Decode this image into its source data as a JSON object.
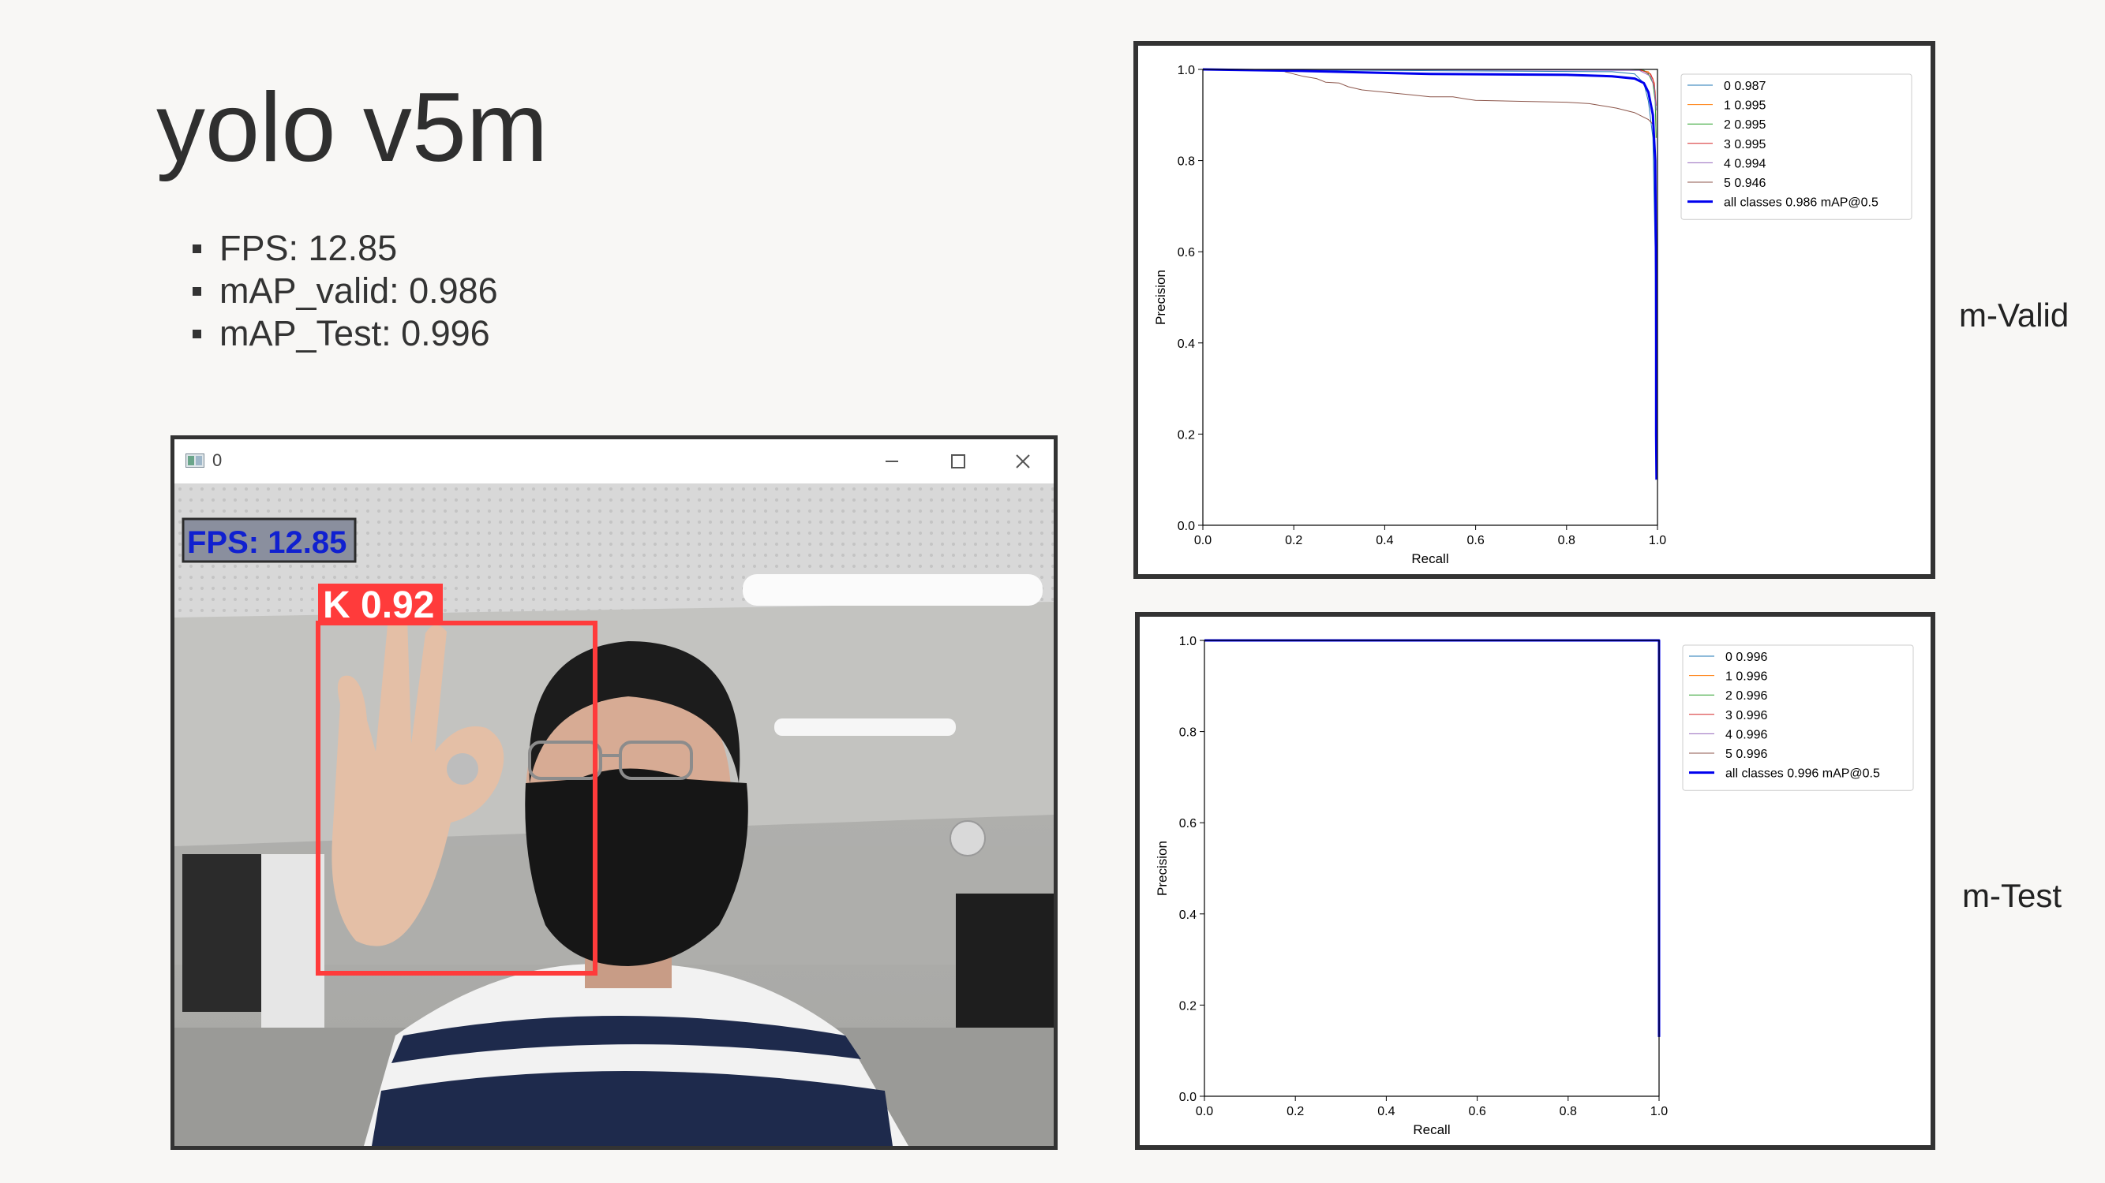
{
  "slide": {
    "title": "yolo v5m",
    "bullets": [
      "FPS: 12.85",
      "mAP_valid: 0.986",
      "mAP_Test: 0.996"
    ],
    "valid_label": "m-Valid",
    "test_label": "m-Test"
  },
  "camera_window": {
    "title": "0",
    "fps_overlay": "FPS: 12.85",
    "detection_label": "K 0.92",
    "icons": [
      "app-icon",
      "minimize-icon",
      "maximize-icon",
      "close-icon"
    ]
  },
  "colors": {
    "detection_box": "#ff3b3b",
    "fps_text": "#1020d0",
    "all_classes": "#0000ee",
    "class_0": "#1f77b4",
    "class_1": "#ff7f0e",
    "class_2": "#2ca02c",
    "class_3": "#d62728",
    "class_4": "#9467bd",
    "class_5": "#8c564b"
  },
  "chart_data": [
    {
      "type": "line",
      "xlabel": "Recall",
      "ylabel": "Precision",
      "xlim": [
        0,
        1
      ],
      "ylim": [
        0,
        1
      ],
      "xticks": [
        "0.0",
        "0.2",
        "0.4",
        "0.6",
        "0.8",
        "1.0"
      ],
      "yticks": [
        "0.0",
        "0.2",
        "0.4",
        "0.6",
        "0.8",
        "1.0"
      ],
      "legend_position": "top-right",
      "series": [
        {
          "name": "0 0.987",
          "color": "#1f77b4",
          "width": 1,
          "x": [
            0,
            0.9,
            0.95,
            0.97,
            0.98,
            0.99,
            0.995,
            0.996,
            0.996
          ],
          "y": [
            1,
            0.995,
            0.99,
            0.97,
            0.93,
            0.85,
            0.6,
            0.3,
            0.2
          ]
        },
        {
          "name": "1 0.995",
          "color": "#ff7f0e",
          "width": 1,
          "x": [
            0,
            0.95,
            0.98,
            0.99,
            0.995,
            0.997
          ],
          "y": [
            1,
            1,
            0.995,
            0.98,
            0.95,
            0.85
          ]
        },
        {
          "name": "2 0.995",
          "color": "#2ca02c",
          "width": 1,
          "x": [
            0,
            0.94,
            0.97,
            0.98,
            0.99,
            0.995,
            0.997
          ],
          "y": [
            1,
            1,
            0.998,
            0.99,
            0.97,
            0.93,
            0.85
          ]
        },
        {
          "name": "3 0.995",
          "color": "#d62728",
          "width": 1,
          "x": [
            0,
            0.96,
            0.985,
            0.993,
            0.997
          ],
          "y": [
            1,
            1,
            0.99,
            0.97,
            0.92
          ]
        },
        {
          "name": "4 0.994",
          "color": "#9467bd",
          "width": 1,
          "x": [
            0,
            0.96,
            0.985,
            0.993,
            0.997
          ],
          "y": [
            1,
            0.998,
            0.985,
            0.96,
            0.91
          ]
        },
        {
          "name": "5 0.946",
          "color": "#8c564b",
          "width": 1,
          "x": [
            0.18,
            0.2,
            0.22,
            0.25,
            0.27,
            0.3,
            0.32,
            0.35,
            0.38,
            0.4,
            0.45,
            0.5,
            0.55,
            0.58,
            0.6,
            0.7,
            0.8,
            0.85,
            0.88,
            0.91,
            0.93,
            0.95,
            0.96,
            0.97,
            0.98,
            0.99
          ],
          "y": [
            0.995,
            0.99,
            0.985,
            0.98,
            0.972,
            0.97,
            0.962,
            0.955,
            0.952,
            0.95,
            0.945,
            0.94,
            0.94,
            0.935,
            0.932,
            0.93,
            0.928,
            0.925,
            0.92,
            0.915,
            0.91,
            0.905,
            0.9,
            0.895,
            0.89,
            0.88
          ]
        },
        {
          "name": "all classes 0.986 mAP@0.5",
          "color": "#0000ee",
          "width": 3,
          "x": [
            0,
            0.2,
            0.5,
            0.8,
            0.9,
            0.95,
            0.97,
            0.98,
            0.99,
            0.995,
            0.997,
            0.997,
            0.998
          ],
          "y": [
            1,
            0.997,
            0.99,
            0.988,
            0.985,
            0.98,
            0.97,
            0.95,
            0.9,
            0.8,
            0.55,
            0.2,
            0.1
          ]
        }
      ]
    },
    {
      "type": "line",
      "xlabel": "Recall",
      "ylabel": "Precision",
      "xlim": [
        0,
        1
      ],
      "ylim": [
        0,
        1
      ],
      "xticks": [
        "0.0",
        "0.2",
        "0.4",
        "0.6",
        "0.8",
        "1.0"
      ],
      "yticks": [
        "0.0",
        "0.2",
        "0.4",
        "0.6",
        "0.8",
        "1.0"
      ],
      "legend_position": "top-right",
      "series": [
        {
          "name": "0 0.996",
          "color": "#1f77b4",
          "width": 1,
          "x": [
            0,
            1,
            1
          ],
          "y": [
            1,
            1,
            0.13
          ]
        },
        {
          "name": "1 0.996",
          "color": "#ff7f0e",
          "width": 1,
          "x": [
            0,
            1,
            1
          ],
          "y": [
            1,
            1,
            0.13
          ]
        },
        {
          "name": "2 0.996",
          "color": "#2ca02c",
          "width": 1,
          "x": [
            0,
            1,
            1
          ],
          "y": [
            1,
            1,
            0.13
          ]
        },
        {
          "name": "3 0.996",
          "color": "#d62728",
          "width": 1,
          "x": [
            0,
            1,
            1
          ],
          "y": [
            1,
            1,
            0.13
          ]
        },
        {
          "name": "4 0.996",
          "color": "#9467bd",
          "width": 1,
          "x": [
            0,
            1,
            1
          ],
          "y": [
            1,
            1,
            0.13
          ]
        },
        {
          "name": "5 0.996",
          "color": "#8c564b",
          "width": 1,
          "x": [
            0,
            1,
            1
          ],
          "y": [
            1,
            1,
            0.13
          ]
        },
        {
          "name": "all classes 0.996 mAP@0.5",
          "color": "#0000ee",
          "width": 3,
          "x": [
            0,
            1,
            1
          ],
          "y": [
            1,
            1,
            0.13
          ]
        }
      ]
    }
  ]
}
